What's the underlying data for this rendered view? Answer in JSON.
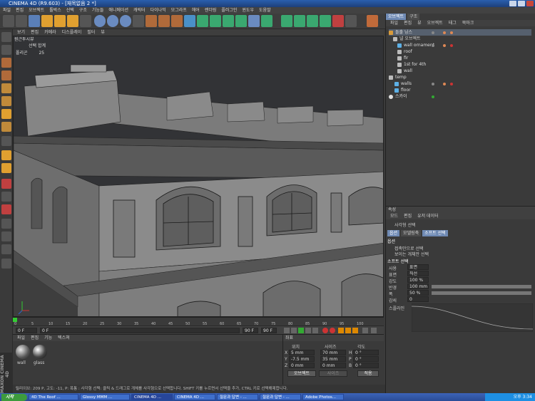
{
  "window": {
    "title": "CINEMA 4D (R9.603) - [재목없음 2 *]"
  },
  "menubar": [
    "파일",
    "편집",
    "오브젝트",
    "툴박스",
    "선택",
    "구조",
    "기능들",
    "애니메이션",
    "캐릭터",
    "다이나믹",
    "모그라프",
    "헤어",
    "렌더링",
    "플러그인",
    "윈도우",
    "도움말"
  ],
  "viewport": {
    "menu": [
      "보기",
      "편집",
      "카메라",
      "디스플레이",
      "필터",
      "뷰"
    ],
    "label": "원근투시뷰",
    "stats_label": "선택 합계",
    "stats_value_label": "폴리곤",
    "stats_value": "25"
  },
  "timeline": {
    "ticks": [
      "0",
      "5",
      "10",
      "15",
      "20",
      "25",
      "30",
      "35",
      "40",
      "45",
      "50",
      "55",
      "60",
      "65",
      "70",
      "75",
      "80",
      "85",
      "90",
      "95",
      "100"
    ],
    "start": "0 F",
    "current": "0 F",
    "end_a": "90 F",
    "end_b": "90 F"
  },
  "materials": {
    "menu": [
      "파일",
      "편집",
      "기능",
      "텍스쳐"
    ],
    "items": [
      {
        "name": "wall"
      },
      {
        "name": "glass"
      }
    ]
  },
  "coords": {
    "header": "좌표",
    "columns": [
      "위치",
      "사이즈",
      "각도"
    ],
    "rows": [
      {
        "axis": "X",
        "pos": "5 mm",
        "size": "70 mm",
        "rot_axis": "H",
        "rot": "0 °"
      },
      {
        "axis": "Y",
        "pos": "-7.5 mm",
        "size": "35 mm",
        "rot_axis": "P",
        "rot": "0 °"
      },
      {
        "axis": "Z",
        "pos": "0 mm",
        "size": "0 mm",
        "rot_axis": "B",
        "rot": "0 °"
      }
    ],
    "mode": "오브젝트",
    "size_mode": "사이즈",
    "apply": "적용"
  },
  "status": "릴리이브: 209 P, 고도: -11, P: 폭통 : 사각형 선택: 클릭 & 드래그로 개체를 사각형으로 선택합니다. SHIFT 키를 누르면서 선택을 추가, CTRL 키로 선택해제합니다.",
  "objects": {
    "tabs": [
      "오브젝트",
      "구조"
    ],
    "menu": [
      "파일",
      "편집",
      "뷰",
      "오브젝트",
      "태그",
      "북마크"
    ],
    "rows": [
      {
        "name": "돌출 닝스",
        "indent": 0,
        "color": "#d89a3a",
        "highlight": true
      },
      {
        "name": "널 오브젝트",
        "indent": 1,
        "color": "#bbbbbb",
        "highlight": false
      },
      {
        "name": "wall ornament",
        "indent": 2,
        "color": "#5db0e6",
        "highlight": false
      },
      {
        "name": "roof",
        "indent": 1,
        "color": "#bbbbbb",
        "highlight": false
      },
      {
        "name": "fir",
        "indent": 1,
        "color": "#bbbbbb",
        "highlight": false
      },
      {
        "name": "1st for 4th",
        "indent": 1,
        "color": "#bbbbbb",
        "highlight": false
      },
      {
        "name": "wall",
        "indent": 1,
        "color": "#bbbbbb",
        "highlight": false
      },
      {
        "name": "temp",
        "indent": 0,
        "color": "#bbbbbb",
        "highlight": false
      },
      {
        "name": "walls",
        "indent": 1,
        "color": "#5db0e6",
        "highlight": false
      },
      {
        "name": "floor",
        "indent": 1,
        "color": "#5db0e6",
        "highlight": false
      },
      {
        "name": "스카이",
        "indent": 0,
        "color": "#e0e0e0",
        "highlight": false
      }
    ]
  },
  "attributes": {
    "header": "속성",
    "menu": [
      "모드",
      "편집",
      "유저 데이터"
    ],
    "tool_name": "사각형 선택",
    "tool_sub": "사각형 선택",
    "tabs": [
      "옵션",
      "모델링축",
      "소프트 선택"
    ],
    "section_options": "옵션",
    "opt1": "접촉만으로 선택",
    "opt2": "보이는 개체만 선택",
    "section_soft": "소프트 선택",
    "soft_rows": [
      {
        "label": "사용",
        "value": "표면"
      },
      {
        "label": "표면",
        "value": "직선"
      },
      {
        "label": "강도",
        "value": "100 %"
      },
      {
        "label": "반경",
        "value": "100 mm"
      },
      {
        "label": "폭",
        "value": "50 %"
      },
      {
        "label": "감쇠",
        "value": "0"
      }
    ],
    "curve_label": "스플라인"
  },
  "taskbar": {
    "start": "시작",
    "tasks": [
      "4D The Roof ...",
      "Glossy MMM ...",
      "CINEMA 4D ...",
      "CINEMA 4D ...",
      "질문과 답변 - ...",
      "질문과 답변 - ...",
      "Adobe Photos..."
    ],
    "clock": "오후 3:34"
  },
  "colors": {
    "accent": "#6f8ab4",
    "selection": "#56606e",
    "start": "#3d9b3d"
  }
}
